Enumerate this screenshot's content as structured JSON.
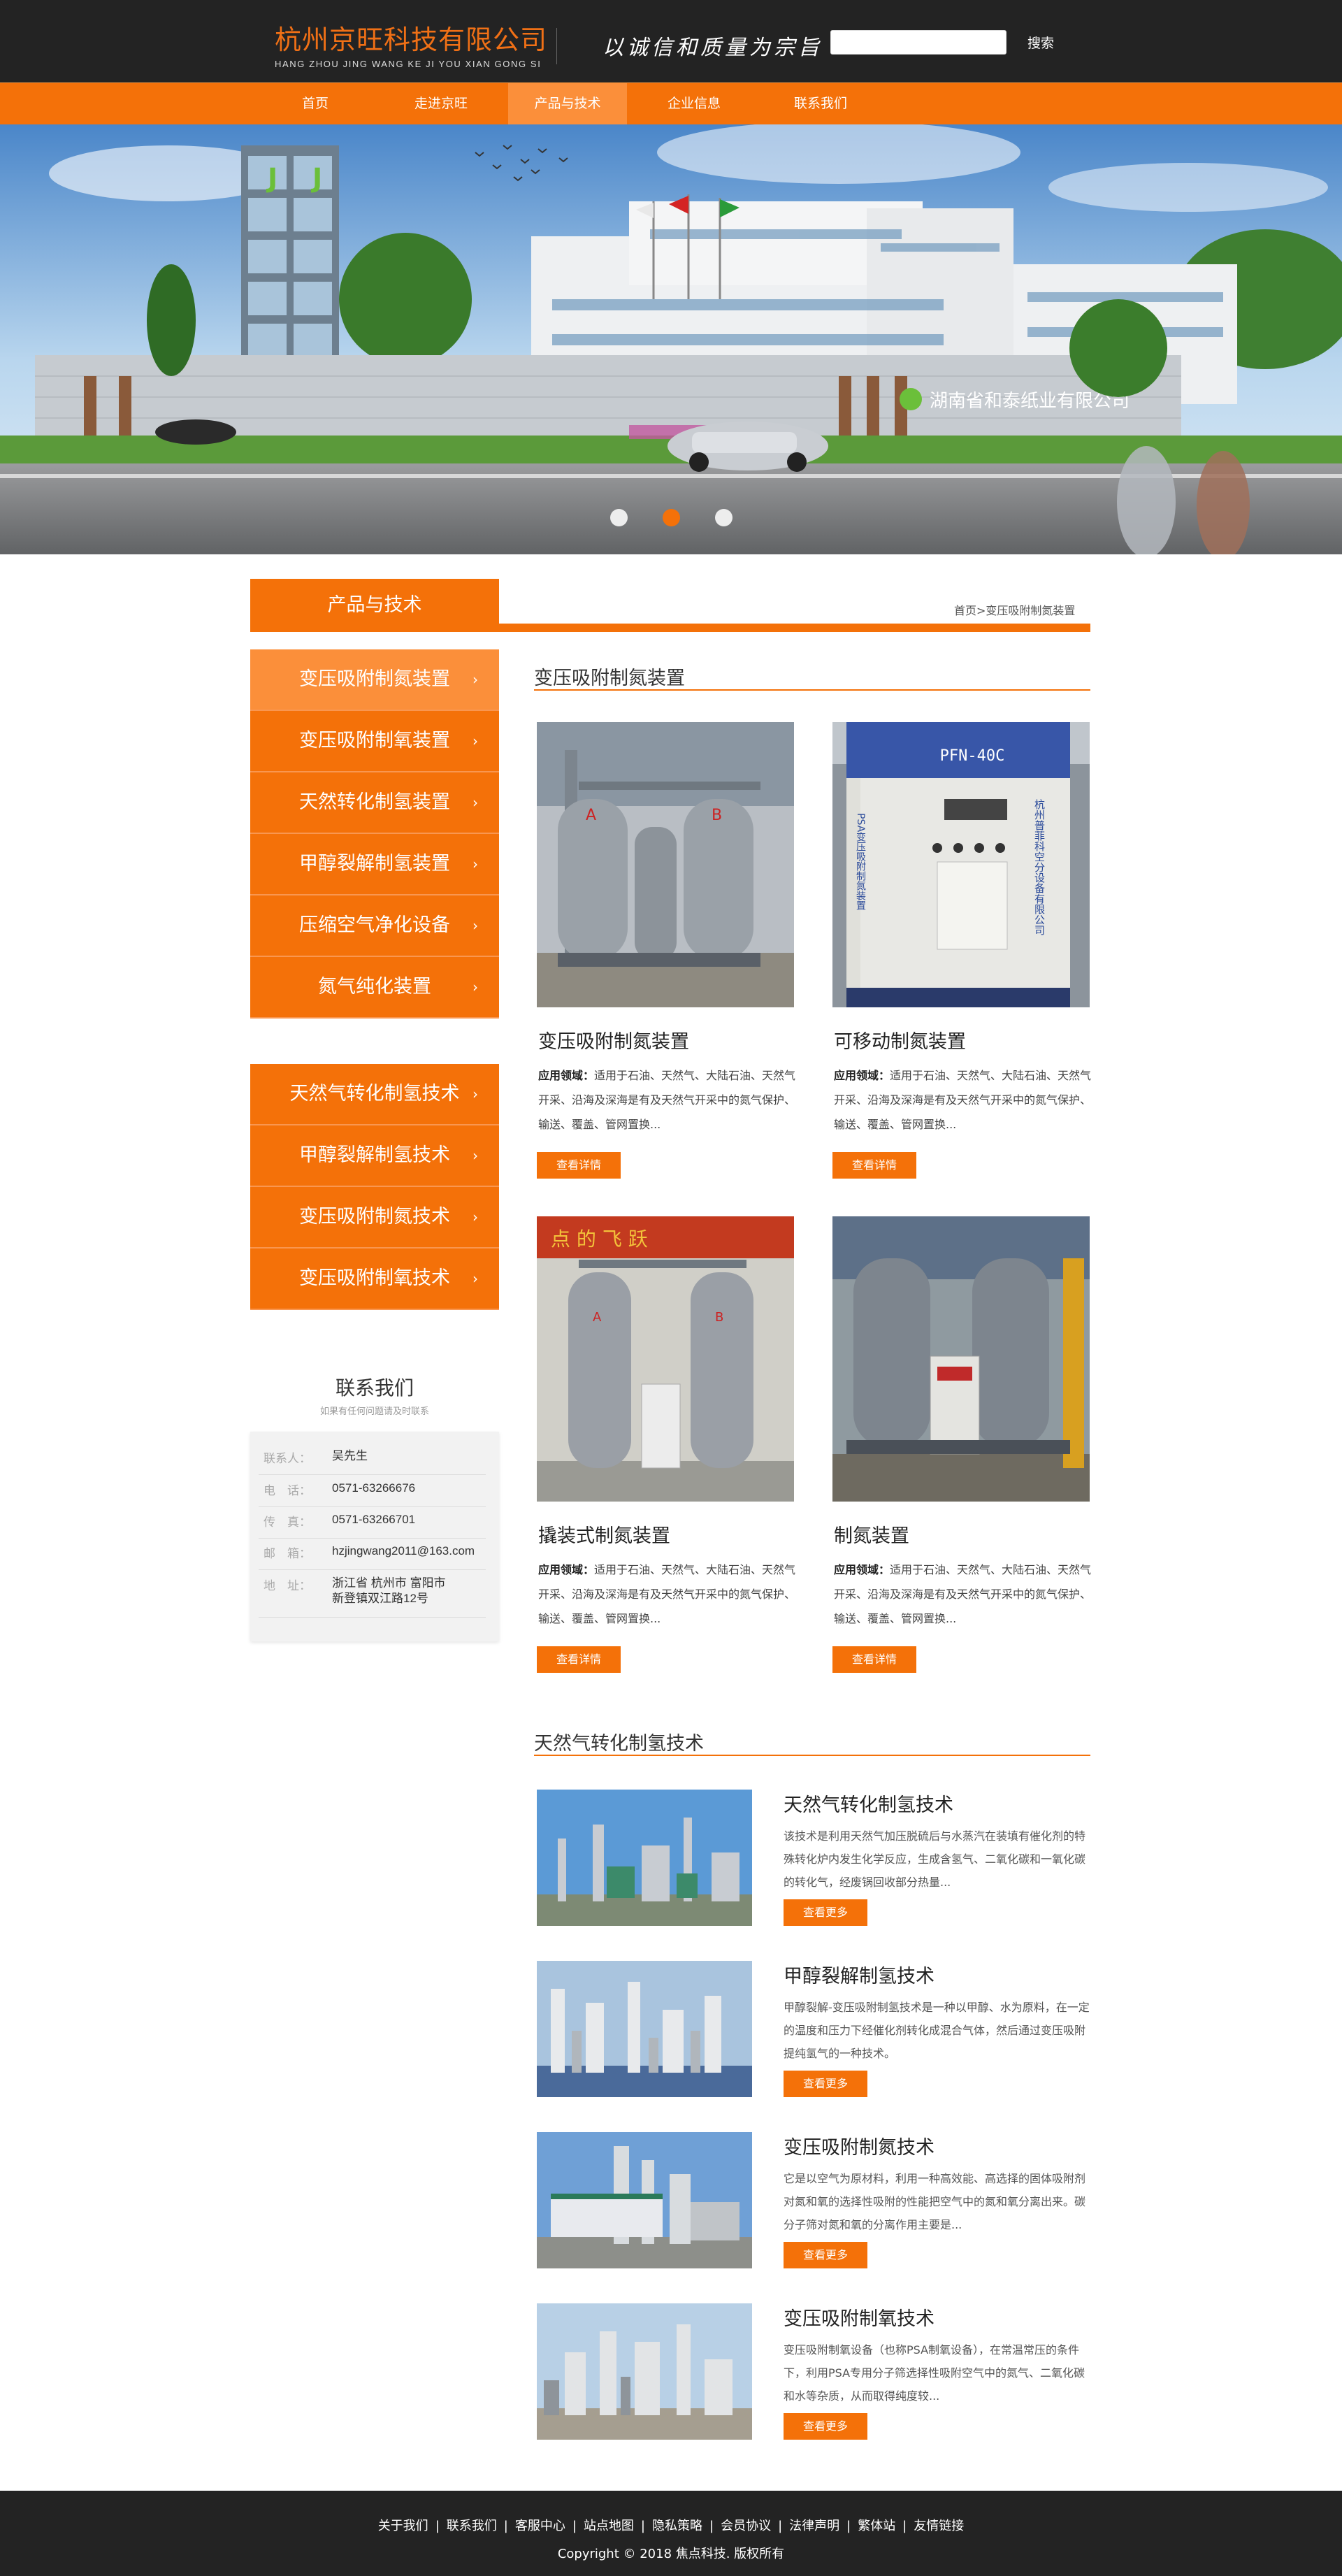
{
  "header": {
    "logo_cn": "杭州京旺科技有限公司",
    "logo_en": "HANG ZHOU JING WANG KE JI YOU XIAN GONG SI",
    "slogan": "以诚信和质量为宗旨",
    "search_placeholder": "",
    "search_label": "搜索"
  },
  "nav": {
    "items": [
      "首页",
      "走进京旺",
      "产品与技术",
      "企业信息",
      "联系我们"
    ],
    "active_index": 2
  },
  "banner": {
    "sign_text": "湖南省和泰纸业有限公司",
    "slides": 3,
    "active_slide": 2
  },
  "sidebar": {
    "title": "产品与技术",
    "menu1": [
      "变压吸附制氮装置",
      "变压吸附制氧装置",
      "天然转化制氢装置",
      "甲醇裂解制氢装置",
      "压缩空气净化设备",
      "氮气纯化装置"
    ],
    "menu2": [
      "天然气转化制氢技术",
      "甲醇裂解制氢技术",
      "变压吸附制氮技术",
      "变压吸附制氧技术"
    ],
    "arrow": "›"
  },
  "breadcrumb": {
    "home": "首页",
    "sep": ">",
    "current": "变压吸附制氮装置"
  },
  "contact": {
    "title": "联系我们",
    "subtitle": "如果有任何问题请及时联系",
    "rows": [
      {
        "k": "联系人：",
        "v": "吴先生"
      },
      {
        "k": "电　话：",
        "v": "0571-63266676"
      },
      {
        "k": "传　真：",
        "v": "0571-63266701"
      },
      {
        "k": "邮　箱：",
        "v": "hzjingwang2011@163.com"
      },
      {
        "k": "地　址：",
        "v": "浙江省 杭州市 富阳市",
        "v2": "新登镇双江路12号"
      }
    ]
  },
  "products": {
    "heading": "变压吸附制氮装置",
    "usage_label": "应用领域：",
    "button": "查看详情",
    "items": [
      {
        "name": "变压吸附制氮装置",
        "desc": "适用于石油、天然气、大陆石油、天然气开采、沿海及深海是有及天然气开采中的氮气保护、输送、覆盖、管网置换..."
      },
      {
        "name": "可移动制氮装置",
        "desc": "适用于石油、天然气、大陆石油、天然气开采、沿海及深海是有及天然气开采中的氮气保护、输送、覆盖、管网置换..."
      },
      {
        "name": "撬装式制氮装置",
        "desc": "适用于石油、天然气、大陆石油、天然气开采、沿海及深海是有及天然气开采中的氮气保护、输送、覆盖、管网置换..."
      },
      {
        "name": "制氮装置",
        "desc": "适用于石油、天然气、大陆石油、天然气开采、沿海及深海是有及天然气开采中的氮气保护、输送、覆盖、管网置换..."
      }
    ],
    "machine_label": "PFN-40C",
    "machine_side_text": "杭州普菲科空分设备有限公司",
    "machine_front_text": "PSA变压吸附制氮装置",
    "wall_text": "点  的  飞 跃"
  },
  "tech": {
    "heading": "天然气转化制氢技术",
    "button": "查看更多",
    "items": [
      {
        "name": "天然气转化制氢技术",
        "desc": "该技术是利用天然气加压脱硫后与水蒸汽在装填有催化剂的特殊转化炉内发生化学反应，生成含氢气、二氧化碳和一氧化碳的转化气，经废锅回收部分热量..."
      },
      {
        "name": "甲醇裂解制氢技术",
        "desc": "甲醇裂解-变压吸附制氢技术是一种以甲醇、水为原料，在一定的温度和压力下经催化剂转化成混合气体，然后通过变压吸附提纯氢气的一种技术。"
      },
      {
        "name": "变压吸附制氮技术",
        "desc": "它是以空气为原材料，利用一种高效能、高选择的固体吸附剂对氮和氧的选择性吸附的性能把空气中的氮和氧分离出来。碳分子筛对氮和氧的分离作用主要是..."
      },
      {
        "name": "变压吸附制氧技术",
        "desc": "变压吸附制氧设备（也称PSA制氧设备），在常温常压的条件下，利用PSA专用分子筛选择性吸附空气中的氮气、二氧化碳和水等杂质，从而取得纯度较..."
      }
    ]
  },
  "footer": {
    "links": [
      "关于我们",
      "联系我们",
      "客服中心",
      "站点地图",
      "隐私策略",
      "会员协议",
      "法律声明",
      "繁体站",
      "友情链接"
    ],
    "sep": "|",
    "copyright": "Copyright © 2018 焦点科技. 版权所有"
  },
  "colors": {
    "accent": "#f47109",
    "dark": "#232323",
    "accent_light": "#fb8f3a"
  }
}
